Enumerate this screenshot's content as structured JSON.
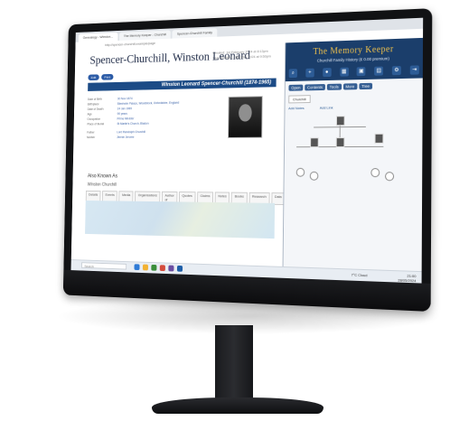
{
  "browser": {
    "tabs": [
      "Genealogy - Winston...",
      "The Memory Keeper - Churchill",
      "Spencer-Churchill Family"
    ],
    "address": "http://spencer-churchill.example/page"
  },
  "page": {
    "title": "Spencer-Churchill, Winston Leonard",
    "created": "Created: 1st February 2024 at 8:13pm",
    "modified": "Last modified: 28th May 2024 at 9:50pm",
    "pill1": "Edit",
    "pill2": "Print",
    "banner": "Winston Leonard Spencer-Churchill (1874-1965)",
    "facts": [
      {
        "label": "Date of Birth",
        "value": "30 Nov 1874"
      },
      {
        "label": "Birthplace",
        "value": "Blenheim Palace, Woodstock, Oxfordshire, England"
      },
      {
        "label": "Date of Death",
        "value": "24 Jan 1965"
      },
      {
        "label": "Age",
        "value": "90 years"
      },
      {
        "label": "Occupation",
        "value": "Prime Minister"
      },
      {
        "label": "Place of Burial",
        "value": "St Martin's Church, Bladon"
      },
      {
        "label": "Father",
        "value": "Lord Randolph Churchill"
      },
      {
        "label": "Mother",
        "value": "Jennie Jerome"
      }
    ],
    "aka_title": "Also Known As",
    "aka_value": "Winston Churchill",
    "subtabs": [
      "Details",
      "Events",
      "Media",
      "Organisations",
      "Author of",
      "Quotes",
      "Claims",
      "Notes",
      "Books",
      "Research",
      "Data"
    ]
  },
  "app": {
    "title": "The Memory Keeper",
    "subtitle": "Churchill Family History (£ 0.00 premium)",
    "menu": [
      "Open",
      "Contents",
      "Tools",
      "More",
      "Tree"
    ],
    "filter": "Churchill",
    "add_link": "Add Notes",
    "find_link": "Add Link"
  },
  "taskbar": {
    "search": "Search",
    "weather": "7°C  Cloud",
    "time": "21:00",
    "date": "28/05/2024"
  },
  "colors": {
    "brand": "#1b3e6b",
    "accent": "#f0c14b",
    "link": "#2a5aa6"
  }
}
